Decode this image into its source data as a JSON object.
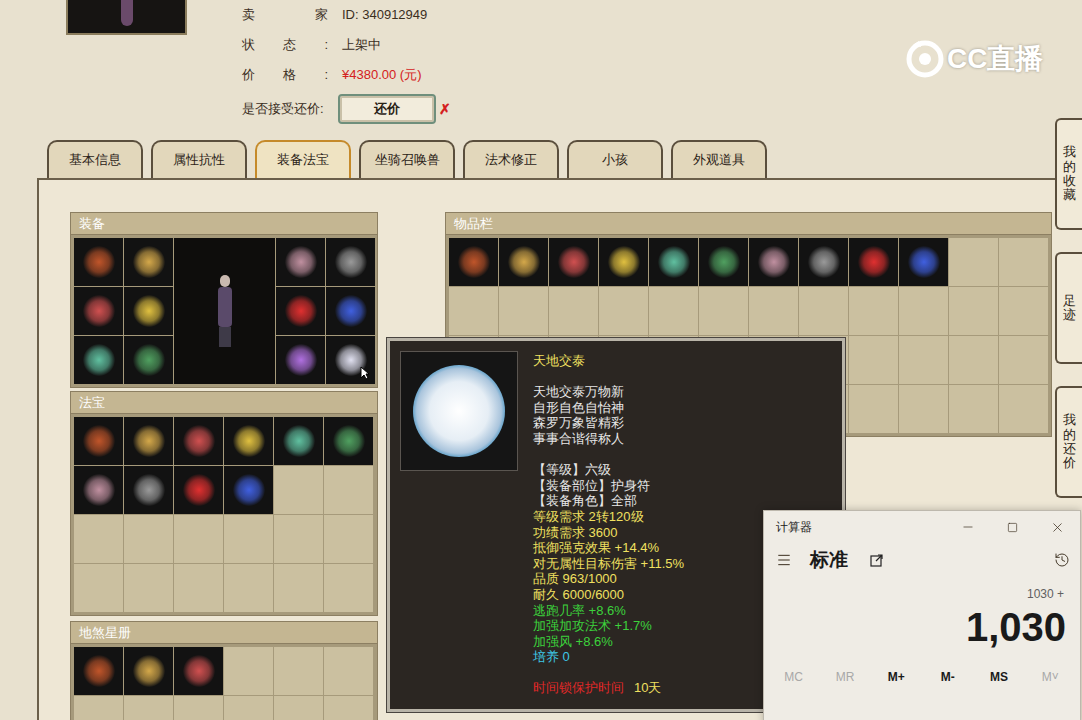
{
  "header": {
    "info": [
      {
        "label": "卖家",
        "value": "ID: 340912949",
        "color": "#3a2e1e"
      },
      {
        "label": "状态:",
        "value": "上架中",
        "color": "#3a2e1e"
      },
      {
        "label": "价格:",
        "value": "¥4380.00 (元)",
        "color": "#d42020"
      }
    ],
    "counter_offer": {
      "label": "是否接受还价:",
      "button": "还价",
      "mark": "✗"
    }
  },
  "watermark": {
    "text": "CC直播"
  },
  "side_tabs": [
    "我的收藏",
    "足迹",
    "我的还价"
  ],
  "tabs": [
    {
      "label": "基本信息",
      "selected": false
    },
    {
      "label": "属性抗性",
      "selected": false
    },
    {
      "label": "装备法宝",
      "selected": true
    },
    {
      "label": "坐骑召唤兽",
      "selected": false
    },
    {
      "label": "法术修正",
      "selected": false
    },
    {
      "label": "小孩",
      "selected": false
    },
    {
      "label": "外观道具",
      "selected": false
    }
  ],
  "equipment": {
    "title": "装备",
    "slots": 12,
    "filled": 12,
    "hovered": 11
  },
  "treasures": {
    "title": "法宝",
    "slots": 24,
    "filled": 10
  },
  "star_book": {
    "title": "地煞星册",
    "slots": 12,
    "filled": 3
  },
  "inventory": {
    "title": "物品栏",
    "slots": 48,
    "filled": 10
  },
  "tooltip": {
    "title": "天地交泰",
    "poem": [
      "天地交泰万物新",
      "自形自色自怡神",
      "森罗万象皆精彩",
      "事事合谐得称人"
    ],
    "lines": [
      {
        "text": "【等级】六级",
        "color": "#e8e8e8"
      },
      {
        "text": "【装备部位】护身符",
        "color": "#e8e8e8"
      },
      {
        "text": "【装备角色】全部",
        "color": "#e8e8e8"
      },
      {
        "text": "等级需求 2转120级",
        "color": "#f0e060"
      },
      {
        "text": "功绩需求 3600",
        "color": "#f0e060"
      },
      {
        "text": "抵御强克效果 +14.4%",
        "color": "#f0e060"
      },
      {
        "text": "对无属性目标伤害 +11.5%",
        "color": "#f0e060"
      },
      {
        "text": "品质 963/1000",
        "color": "#f0e060"
      },
      {
        "text": "耐久 6000/6000",
        "color": "#f0e060"
      },
      {
        "text": "逃跑几率 +8.6%",
        "color": "#3cd23c"
      },
      {
        "text": "加强加攻法术 +1.7%",
        "color": "#3cd23c"
      },
      {
        "text": "加强风 +8.6%",
        "color": "#3cd23c"
      },
      {
        "text": "培养 0",
        "color": "#3ec8e6"
      }
    ],
    "lock": {
      "label": "时间锁保护时间",
      "value": "10天",
      "label_color": "#e02828",
      "value_color": "#f0e060"
    }
  },
  "calculator": {
    "title": "计算器",
    "mode": "标准",
    "expression": "1030 +",
    "display": "1,030",
    "memory": [
      {
        "label": "MC",
        "disabled": true
      },
      {
        "label": "MR",
        "disabled": true
      },
      {
        "label": "M+",
        "disabled": false
      },
      {
        "label": "M-",
        "disabled": false
      },
      {
        "label": "MS",
        "disabled": false
      },
      {
        "label": "M˅",
        "disabled": true
      }
    ]
  }
}
